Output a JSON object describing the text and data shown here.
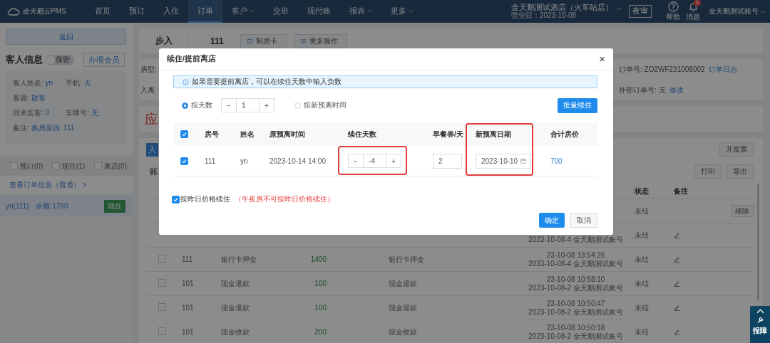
{
  "nav": {
    "logo": "金天鹅云PMS",
    "items": [
      {
        "label": "首页",
        "selected": false,
        "dropdown": false
      },
      {
        "label": "预订",
        "selected": false,
        "dropdown": false
      },
      {
        "label": "入住",
        "selected": false,
        "dropdown": false
      },
      {
        "label": "订单",
        "selected": true,
        "dropdown": false
      },
      {
        "label": "客户",
        "selected": false,
        "dropdown": true
      },
      {
        "label": "交班",
        "selected": false,
        "dropdown": false
      },
      {
        "label": "现付账",
        "selected": false,
        "dropdown": false
      },
      {
        "label": "报表",
        "selected": false,
        "dropdown": true
      },
      {
        "label": "更多",
        "selected": false,
        "dropdown": true
      }
    ],
    "hotel": "金天鹅测试酒店（火车站店）",
    "business_date": "营业日：2023-10-08",
    "night_audit": "夜审",
    "help": "帮助",
    "messages": {
      "label": "消息",
      "badge": "6"
    },
    "account": "金天鹅测试账号"
  },
  "sidebar": {
    "back": "返回",
    "guest_title": "客人信息",
    "privacy": {
      "label": "保密",
      "on": false
    },
    "member_button": "办理会员",
    "fields": [
      {
        "label": "客人姓名:",
        "value": "yn"
      },
      {
        "label": "手机:",
        "value": "无"
      },
      {
        "label": "客源:",
        "value": "散客"
      },
      {
        "label": "同来宾客:",
        "value": "0"
      },
      {
        "label": "车牌号:",
        "value": "无"
      },
      {
        "label": "备注:",
        "value": "换房原因: 111"
      }
    ],
    "filters": [
      {
        "label": "预订(0)",
        "checked": false
      },
      {
        "label": "现住(1)",
        "checked": false
      },
      {
        "label": "离店(0)",
        "checked": false
      }
    ],
    "order_link": "查看订单信息（普通） >",
    "rooms": [
      {
        "name": "yn(111)",
        "balance": "余额:1750",
        "status": "现住",
        "selected": true
      }
    ]
  },
  "header": {
    "title": "步入",
    "room": "111",
    "buttons": [
      {
        "label": "制房卡",
        "kind": "card"
      },
      {
        "label": "更多操作",
        "kind": "list"
      }
    ]
  },
  "info": {
    "room_type": "房型:",
    "stay": "入离",
    "order_no": "订单号: ZO2WF231008002",
    "order_log": "订单日志",
    "external_no": "外部订单号: 无",
    "edit": "修改"
  },
  "amount_title": "应",
  "bills": {
    "primary_button": "入",
    "invoice_button": "开发票",
    "title": "账",
    "actions": [
      "打印",
      "导出"
    ],
    "columns": [
      "状态",
      "备注"
    ],
    "rows": [
      {
        "room": "",
        "item": "",
        "amount": "",
        "description": "",
        "time": "",
        "operator": "",
        "status": "未结",
        "action": "移除"
      },
      {
        "room": "",
        "item": "",
        "amount": "",
        "description": "",
        "time": "",
        "operator": "2023-10-08-4 金天鹅测试账号",
        "status": "未结",
        "editable": true,
        "action": ""
      },
      {
        "checked": false,
        "room": "111",
        "item": "银行卡押金",
        "amount": "1400",
        "description": "银行卡押金",
        "time": "23-10-08 13:54:26",
        "operator": "2023-10-08-4 金天鹅测试账号",
        "status": "未结",
        "editable": true,
        "action": ""
      },
      {
        "checked": false,
        "room": "101",
        "item": "现金退款",
        "amount": "100",
        "description": "现金退款",
        "time": "23-10-08 10:58:10",
        "operator": "2023-10-08-2 金天鹅测试账号",
        "status": "未结",
        "editable": true,
        "action": ""
      },
      {
        "checked": false,
        "room": "101",
        "item": "现金退款",
        "amount": "100",
        "description": "现金退款",
        "time": "23-10-08 10:50:47",
        "operator": "2023-10-08-2 金天鹅测试账号",
        "status": "未结",
        "editable": true,
        "action": ""
      },
      {
        "checked": false,
        "room": "101",
        "item": "现金收款",
        "amount": "200",
        "description": "现金收款",
        "time": "23-10-08 10:50:18",
        "operator": "2023-10-08-2 金天鹅测试账号",
        "status": "未结",
        "editable": true,
        "action": ""
      }
    ]
  },
  "dialog": {
    "title": "续住/提前离店",
    "close": "×",
    "notice": "如果需要提前离店，可以在续住天数中输入负数",
    "modes": [
      {
        "label": "按天数",
        "selected": true
      },
      {
        "label": "按新预离时间",
        "selected": false
      }
    ],
    "days": {
      "minus": "−",
      "value": "1",
      "plus": "+"
    },
    "batch_button": "批量续住",
    "columns": [
      "房号",
      "姓名",
      "原预离时间",
      "续住天数",
      "早餐券/天",
      "新预离日期",
      "合计房价"
    ],
    "all_checked": true,
    "rows": [
      {
        "checked": true,
        "room": "111",
        "name": "yn",
        "original_departure": "2023-10-14 14:00",
        "minus": "−",
        "days": "-4",
        "plus": "+",
        "breakfast": "2",
        "new_departure": "2023-10-10",
        "total": "700"
      }
    ],
    "yesterday_price": {
      "label": "按昨日价格续住",
      "checked": true,
      "note": "（午夜房不可按昨日价格续住）"
    },
    "confirm": "确定",
    "cancel": "取消"
  },
  "report_widget": {
    "label": "报障"
  }
}
